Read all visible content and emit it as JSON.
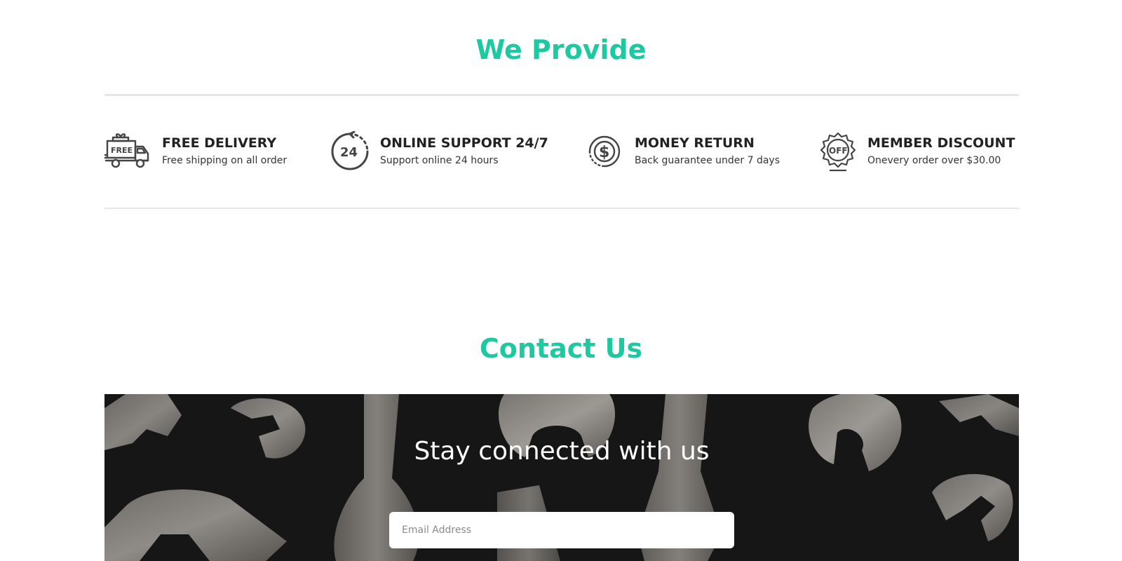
{
  "provide": {
    "title": "We Provide",
    "features": [
      {
        "icon": "free-delivery-truck-icon",
        "title": "FREE DELIVERY",
        "description": "Free shipping on all order"
      },
      {
        "icon": "support-24-icon",
        "title": "ONLINE SUPPORT 24/7",
        "description": "Support online 24 hours"
      },
      {
        "icon": "money-return-icon",
        "title": "MONEY RETURN",
        "description": "Back guarantee under 7 days"
      },
      {
        "icon": "discount-badge-icon",
        "title": "MEMBER DISCOUNT",
        "description": "Onevery order over $30.00"
      }
    ]
  },
  "contact": {
    "title": "Contact Us",
    "banner_heading": "Stay connected with us",
    "email_placeholder": "Email Address",
    "email_value": ""
  },
  "colors": {
    "accent": "#1dc9a0",
    "divider": "#e6e6e6",
    "icon": "#444444"
  }
}
